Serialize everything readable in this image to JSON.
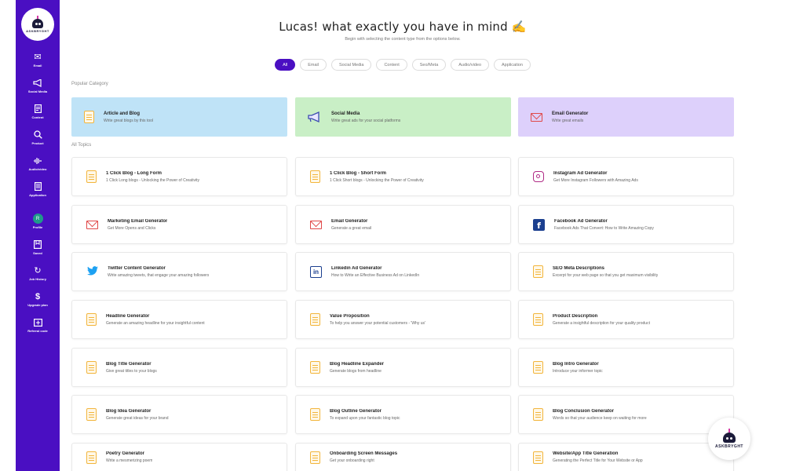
{
  "brand": {
    "name": "ASKBRYGHT"
  },
  "sidebar": {
    "items": [
      {
        "label": "Email",
        "icon": "mail-icon"
      },
      {
        "label": "Social Media",
        "icon": "megaphone-icon"
      },
      {
        "label": "Content",
        "icon": "document-icon"
      },
      {
        "label": "Product",
        "icon": "search-icon"
      },
      {
        "label": "Audio/video",
        "icon": "audio-icon"
      },
      {
        "label": "Application",
        "icon": "application-icon"
      },
      {
        "label": "Profile",
        "icon": "avatar",
        "initial": "R"
      },
      {
        "label": "Saved",
        "icon": "bookmark-icon"
      },
      {
        "label": "Job History",
        "icon": "refresh-icon"
      },
      {
        "label": "Upgrade plan",
        "icon": "dollar-icon"
      },
      {
        "label": "Referral code",
        "icon": "referral-icon"
      }
    ]
  },
  "header": {
    "title": "Lucas! what exactly you have in mind ✍️",
    "subtitle": "Begin with selecting the content type from the options below."
  },
  "filters": [
    "All",
    "Email",
    "Social Media",
    "Content",
    "Seo/Meta",
    "Audio/video",
    "Application"
  ],
  "sections": {
    "popular": "Popular Category",
    "all": "All Topics"
  },
  "popular": [
    {
      "title": "Article and Blog",
      "desc": "Write great blogs by this tool",
      "icon": "document-icon",
      "color": "#bfe3f7"
    },
    {
      "title": "Social Media",
      "desc": "Write great ads for your social platforms",
      "icon": "megaphone-icon",
      "color": "#c9efc6"
    },
    {
      "title": "Email Generator",
      "desc": "Write great emails",
      "icon": "mail-icon",
      "color": "#ddd0fb"
    }
  ],
  "topics": [
    {
      "title": "1 Click Blog - Long Form",
      "desc": "1 Click Long blogs - Unlocking the Power of Creativity",
      "icon": "document-icon"
    },
    {
      "title": "1 Click Blog - Short Form",
      "desc": "1 Click Short blogs - Unlocking the Power of Creativity",
      "icon": "document-icon"
    },
    {
      "title": "Instagram Ad Generator",
      "desc": "Get More Instagram Followers with Amazing Ads",
      "icon": "instagram-icon"
    },
    {
      "title": "Marketing Email Generator",
      "desc": "Get More Opens and Clicks",
      "icon": "mail-icon"
    },
    {
      "title": "Email Generator",
      "desc": "Generate a great email",
      "icon": "mail-icon"
    },
    {
      "title": "Facebook Ad Generator",
      "desc": "Facebook Ads That Convert: How to Write Amazing Copy",
      "icon": "facebook-icon"
    },
    {
      "title": "Twitter Content Generator",
      "desc": "Write amazing tweets, that engage your amazing followers",
      "icon": "twitter-icon"
    },
    {
      "title": "Linkedin Ad Generator",
      "desc": "How to Write an Effective Business Ad on LinkedIn",
      "icon": "linkedin-icon"
    },
    {
      "title": "SEO Meta Descriptions",
      "desc": "Excerpt for your web page so that you get maximum visibility",
      "icon": "document-icon"
    },
    {
      "title": "Headline Generator",
      "desc": "Generate an amazing headline for your insightful content",
      "icon": "document-icon"
    },
    {
      "title": "Value Proposition",
      "desc": "To help you answer your potential customers - 'Why us'",
      "icon": "document-icon"
    },
    {
      "title": "Product Description",
      "desc": "Generate a insightful description for your quality product",
      "icon": "document-icon"
    },
    {
      "title": "Blog Title Generator",
      "desc": "Give great titles to your blogs",
      "icon": "document-icon"
    },
    {
      "title": "Blog Headline Expander",
      "desc": "Generate blogs from headline",
      "icon": "document-icon"
    },
    {
      "title": "Blog Intro Generator",
      "desc": "Introduce your informer topic",
      "icon": "document-icon"
    },
    {
      "title": "Blog Idea Generator",
      "desc": "Generate great ideas for your brand",
      "icon": "document-icon"
    },
    {
      "title": "Blog Outline Generator",
      "desc": "To expand upon your fantastic blog topic",
      "icon": "document-icon"
    },
    {
      "title": "Blog Conclusion Generator",
      "desc": "Words so that your audience keep on waiting for more",
      "icon": "document-icon"
    },
    {
      "title": "Poetry Generator",
      "desc": "Write a mesmerizing poem",
      "icon": "document-icon"
    },
    {
      "title": "Onboarding Screen Messages",
      "desc": "Get your onboarding right",
      "icon": "document-icon"
    },
    {
      "title": "Website/App Title Generation",
      "desc": "Generating the Perfect Title for Your Website or App",
      "icon": "document-icon"
    }
  ],
  "colors": {
    "sidebar": "#4a0fc2",
    "accent": "#4a0fc2",
    "doc": "#f2b53c",
    "mail": "#e04848"
  }
}
